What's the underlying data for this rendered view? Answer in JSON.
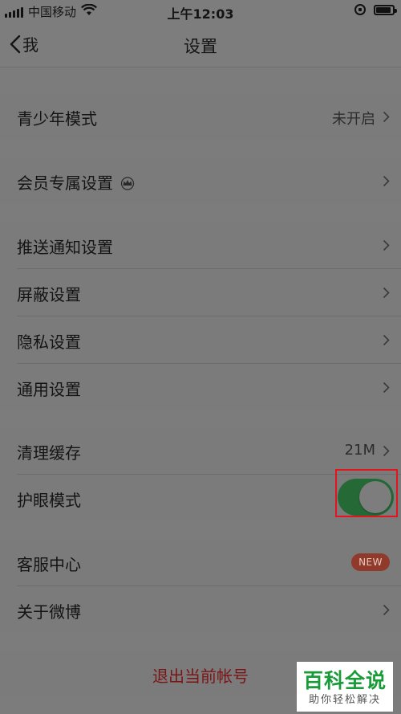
{
  "status_bar": {
    "carrier": "中国移动",
    "time": "上午12:03"
  },
  "nav": {
    "back_label": "我",
    "title": "设置"
  },
  "sections": [
    {
      "items": [
        {
          "label": "青少年模式",
          "value": "未开启"
        }
      ]
    },
    {
      "items": [
        {
          "label": "会员专属设置"
        }
      ]
    },
    {
      "items": [
        {
          "label": "推送通知设置"
        },
        {
          "label": "屏蔽设置"
        },
        {
          "label": "隐私设置"
        },
        {
          "label": "通用设置"
        }
      ]
    },
    {
      "items": [
        {
          "label": "清理缓存",
          "value": "21M"
        },
        {
          "label": "护眼模式",
          "toggle_on": true
        }
      ]
    },
    {
      "items": [
        {
          "label": "客服中心",
          "badge": "NEW"
        },
        {
          "label": "关于微博"
        }
      ]
    }
  ],
  "logout_label": "退出当前帐号",
  "watermark": {
    "title": "百科全说",
    "subtitle": "助你轻松解决"
  },
  "colors": {
    "toggle_on": "#256a36",
    "highlight_box": "#e3141c",
    "logout_text": "#7a1416",
    "badge": "#8f3a2a",
    "watermark_green": "#1a9b3a"
  }
}
